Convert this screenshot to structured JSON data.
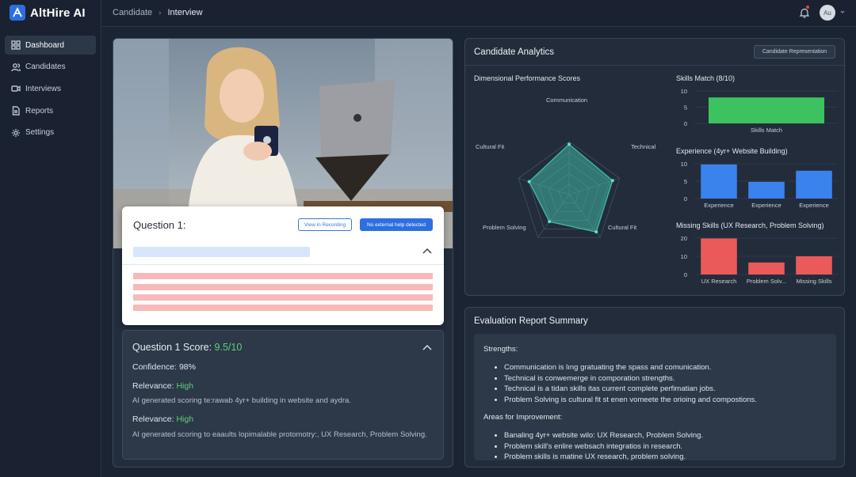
{
  "app": {
    "name": "AltHire AI"
  },
  "nav": {
    "items": [
      {
        "label": "Dashboard",
        "icon": "grid-icon",
        "active": true
      },
      {
        "label": "Candidates",
        "icon": "users-icon",
        "active": false
      },
      {
        "label": "Interviews",
        "icon": "video-icon",
        "active": false
      },
      {
        "label": "Reports",
        "icon": "document-icon",
        "active": false
      },
      {
        "label": "Settings",
        "icon": "gear-icon",
        "active": false
      }
    ]
  },
  "breadcrumb": {
    "parent": "Candidate",
    "current": "Interview"
  },
  "user": {
    "initials": "Au"
  },
  "question": {
    "title": "Question 1:",
    "view_recording": "View in Recording",
    "help_badge": "No external help detected"
  },
  "score": {
    "title": "Question 1 Score: ",
    "value": "9.5/10",
    "confidence": "Confidence: 98%",
    "relevance_label_1": "Relevance: ",
    "relevance_value_1": "High",
    "relevance_text_1": "AI generated scoring te:rawab 4yr+ building in website and aydra.",
    "relevance_label_2": "Relevance: ",
    "relevance_value_2": "High",
    "relevance_text_2": "AI generated scoring to eaaults lopimalable protomotry:, UX Research, Problem Solving."
  },
  "analytics": {
    "title": "Candidate Analytics",
    "button": "Candidate Representation",
    "radar_title": "Dimensional Performance Scores",
    "radar_axes": [
      "Communication",
      "Technical",
      "Cultural Fit",
      "Problem Solving",
      "Cultural Fit"
    ]
  },
  "colors": {
    "green": "#3cc25e",
    "blue": "#3a82ee",
    "red": "#ea5a5a",
    "radar": "#3fb7a4"
  },
  "chart_data": [
    {
      "type": "radar",
      "title": "Dimensional Performance Scores",
      "categories": [
        "Communication",
        "Technical",
        "Cultural Fit",
        "Problem Solving",
        "Cultural Fit"
      ],
      "values": [
        9.5,
        8.6,
        8.7,
        6.3,
        7.9
      ],
      "range": [
        0,
        10
      ]
    },
    {
      "type": "bar",
      "title": "Skills Match (8/10)",
      "categories": [
        "Skills Match"
      ],
      "values": [
        8
      ],
      "ylim": [
        0,
        10
      ],
      "yticks": [
        "10",
        "5",
        "0"
      ],
      "color": "#3cc25e"
    },
    {
      "type": "bar",
      "title": "Experience (4yr+ Website Building)",
      "categories": [
        "Experience",
        "Experience",
        "Experience"
      ],
      "values": [
        9.8,
        4.8,
        8.0
      ],
      "ylim": [
        0,
        10
      ],
      "yticks": [
        "10",
        "5",
        "0"
      ],
      "color": "#3a82ee"
    },
    {
      "type": "bar",
      "title": "Missing Skills (UX Research, Problem Solving)",
      "categories": [
        "UX Research",
        "Problem Solv...",
        "Missing Skills"
      ],
      "values": [
        19.8,
        6.6,
        10.0
      ],
      "ylim": [
        0,
        20
      ],
      "yticks": [
        "20",
        "10",
        "0"
      ],
      "color": "#ea5a5a"
    }
  ],
  "report": {
    "title": "Evaluation Report Summary",
    "strengths_label": "Strengths:",
    "strengths": [
      "Communication is lıng gratuating the spass and comunication.",
      "Technical is conwemerge in comporation strengths.",
      "Technical is a tidan skills itas current complete perfimatian jobs.",
      "Problem Solving is cultural fit st enen vomeete the orioing and compostions."
    ],
    "improve_label": "Areas for Improvement:",
    "improvements": [
      "Banaling 4yr+ website wilo: UX Research, Problem Solving.",
      "Problem skill's enlire websach integratios in research.",
      "Problem skills is matine UX research, problem solving."
    ]
  }
}
